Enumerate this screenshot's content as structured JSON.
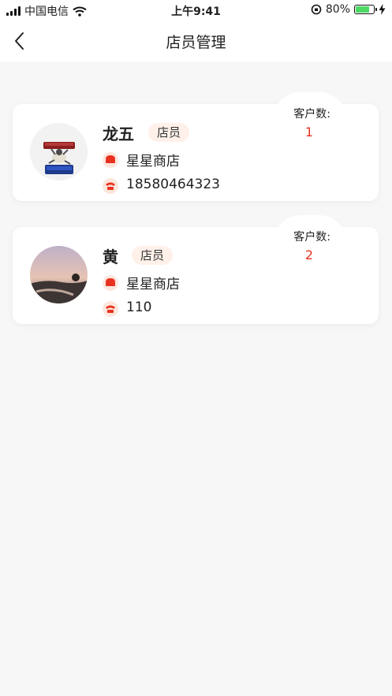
{
  "status_bar": {
    "carrier": "中国电信",
    "time": "上午9:41",
    "battery_percent": "80%",
    "battery_level": 0.8
  },
  "nav": {
    "title": "店员管理"
  },
  "colors": {
    "accent": "#e8321f",
    "badge_bg": "#fff1ea",
    "page_bg": "#f7f7f7"
  },
  "staff": [
    {
      "name": "龙五",
      "role": "店员",
      "store": "星星商店",
      "phone": "18580464323",
      "customer_count_label": "客户数:",
      "customer_count": "1"
    },
    {
      "name": "黄",
      "role": "店员",
      "store": "星星商店",
      "phone": "110",
      "customer_count_label": "客户数:",
      "customer_count": "2"
    }
  ]
}
